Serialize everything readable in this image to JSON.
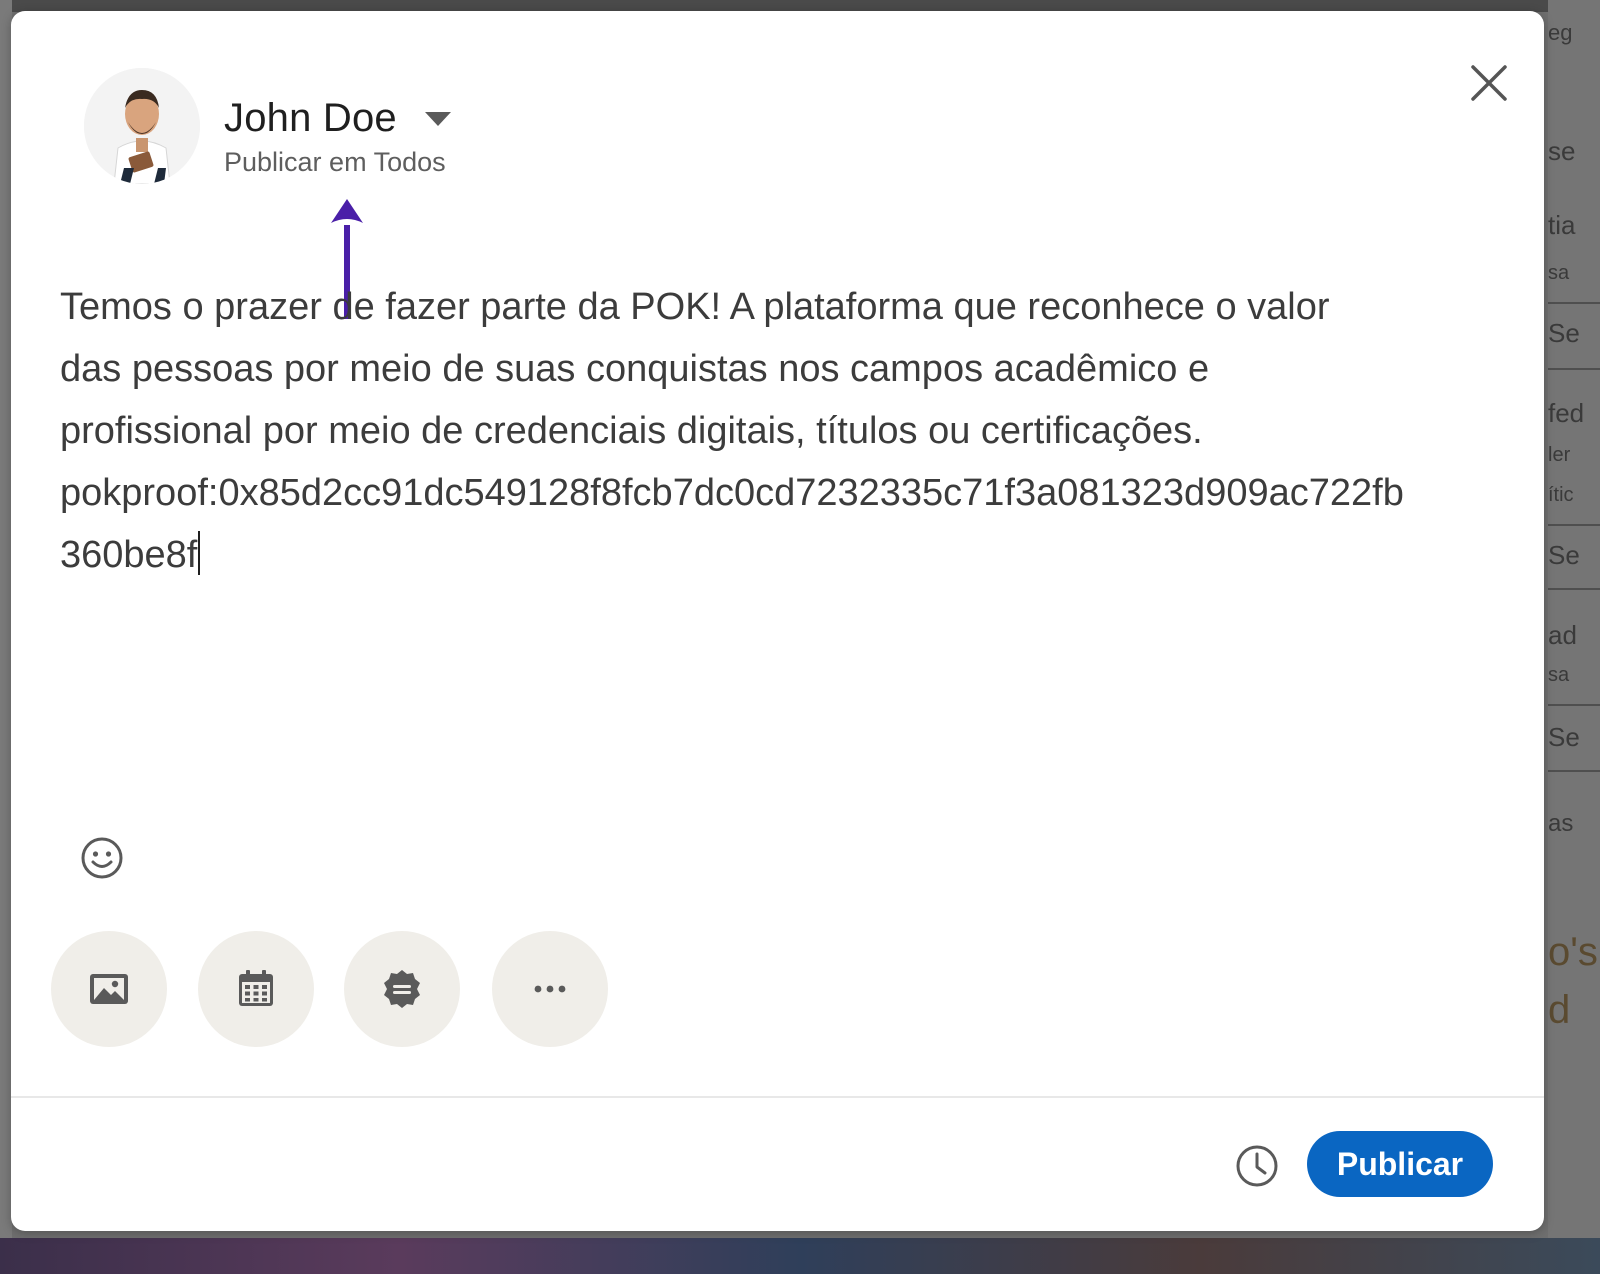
{
  "background": {
    "fragments": [
      "eg",
      "se",
      "tia",
      "sa",
      "Se",
      "fed",
      "ler",
      "ític",
      "Se",
      "ad",
      "sa",
      "Se",
      "as",
      "o's",
      "d"
    ]
  },
  "composer": {
    "author": {
      "name": "John Doe",
      "audience": "Publicar em Todos"
    },
    "post_text_lines": [
      "Temos o prazer de fazer parte da POK! A plataforma que reconhece o valor",
      "das pessoas por meio de suas conquistas nos campos acadêmico e",
      "profissional por meio de credenciais digitais, títulos ou certificações.",
      "pokproof:0x85d2cc91dc549128f8fcb7dc0cd7232335c71f3a081323d909ac722fb",
      "360be8f"
    ],
    "toolbar": {
      "emoji_icon": "smiley-icon",
      "tools": [
        {
          "icon": "image-icon"
        },
        {
          "icon": "calendar-icon"
        },
        {
          "icon": "badge-icon"
        },
        {
          "icon": "more-icon"
        }
      ]
    },
    "footer": {
      "schedule_icon": "clock-icon",
      "publish_label": "Publicar"
    },
    "colors": {
      "publish_button": "#0a66c2",
      "annotation_arrow": "#4a1fa8",
      "tool_button_bg": "#f0eee9"
    }
  }
}
